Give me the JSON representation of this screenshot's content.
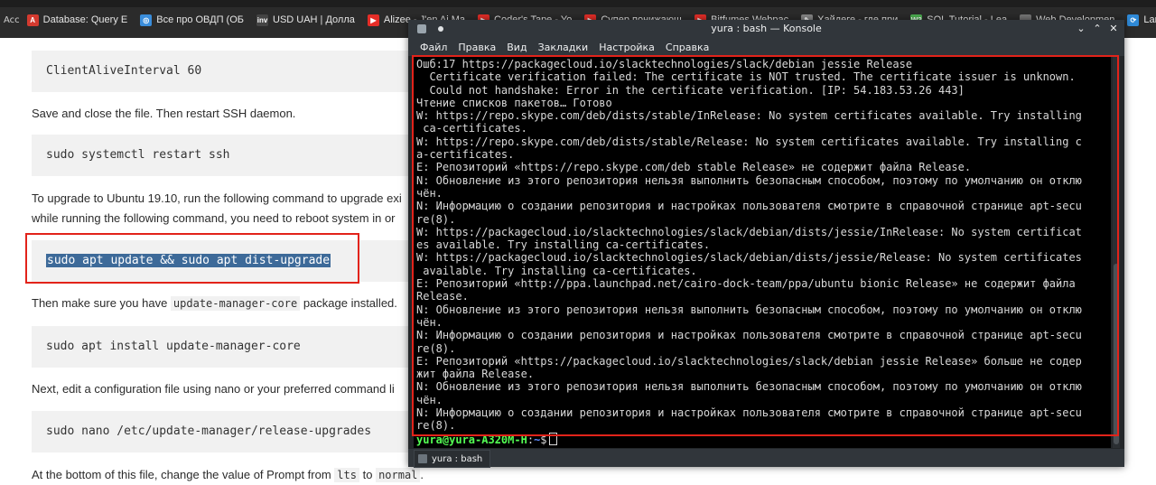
{
  "bookmarks": {
    "first_label": "Acc",
    "items": [
      {
        "label": "Database: Query E",
        "icon": "db-icon",
        "color": "#d43a2f",
        "glyph": "A"
      },
      {
        "label": "Все про ОВДП (ОБ",
        "icon": "globe-icon",
        "color": "#3a8ddb",
        "glyph": "◎"
      },
      {
        "label": "USD UAH | Долла",
        "icon": "chart-icon",
        "color": "#444444",
        "glyph": "inv"
      },
      {
        "label": "Alizee - J'en Ai Ma",
        "icon": "youtube-icon",
        "color": "#e52d27",
        "glyph": "▶"
      },
      {
        "label": "Coder's Tape - Yo",
        "icon": "youtube-icon",
        "color": "#e52d27",
        "glyph": "▶"
      },
      {
        "label": "Супер понижающ",
        "icon": "youtube-icon",
        "color": "#e52d27",
        "glyph": "▶"
      },
      {
        "label": "Bitfumes Webpac",
        "icon": "youtube-icon",
        "color": "#e52d27",
        "glyph": "▶"
      },
      {
        "label": "Хайдеге - где при",
        "icon": "doc-icon",
        "color": "#888888",
        "glyph": "✎"
      },
      {
        "label": "SQL Tutorial - Lea",
        "icon": "w3-icon",
        "color": "#4caf50",
        "glyph": "W3"
      },
      {
        "label": "Web Developmen",
        "icon": "folder-icon",
        "color": "#777777",
        "glyph": "▬"
      },
      {
        "label": "Laravel - Все о WE",
        "icon": "laravel-icon",
        "color": "#2f8ad8",
        "glyph": "⟳"
      }
    ]
  },
  "article": {
    "code1": "ClientAliveInterval 60",
    "para1": "Save and close the file. Then restart SSH daemon.",
    "code2": "sudo systemctl restart ssh",
    "para2_line1": "To upgrade to Ubuntu 19.10, run the following command to upgrade exi",
    "para2_line2": "while running the following command, you need to reboot system in or",
    "code3": "sudo apt update && sudo apt dist-upgrade",
    "para3_pre": "Then make sure you have ",
    "para3_code": "update-manager-core",
    "para3_post": " package installed.",
    "code4": "sudo apt install update-manager-core",
    "para4": "Next, edit a configuration file using nano or your preferred command li",
    "code5": "sudo nano /etc/update-manager/release-upgrades",
    "para5_pre": "At the bottom of this file, change the value of Prompt from ",
    "para5_code1": "lts",
    "para5_mid": " to ",
    "para5_code2": "normal",
    "para5_post": "."
  },
  "konsole": {
    "title": "yura : bash — Konsole",
    "menu": [
      "Файл",
      "Правка",
      "Вид",
      "Закладки",
      "Настройка",
      "Справка"
    ],
    "window_controls": {
      "minimize": "⌄",
      "maximize": "⌃",
      "close": "✕"
    },
    "lines": [
      "Ошб:17 https://packagecloud.io/slacktechnologies/slack/debian jessie Release",
      "  Certificate verification failed: The certificate is NOT trusted. The certificate issuer is unknown.",
      "  Could not handshake: Error in the certificate verification. [IP: 54.183.53.26 443]",
      "Чтение списков пакетов… Готово",
      "W: https://repo.skype.com/deb/dists/stable/InRelease: No system certificates available. Try installing",
      " ca-certificates.",
      "W: https://repo.skype.com/deb/dists/stable/Release: No system certificates available. Try installing c",
      "a-certificates.",
      "E: Репозиторий «https://repo.skype.com/deb stable Release» не содержит файла Release.",
      "N: Обновление из этого репозитория нельзя выполнить безопасным способом, поэтому по умолчанию он отклю",
      "чён.",
      "N: Информацию о создании репозитория и настройках пользователя смотрите в справочной странице apt-secu",
      "re(8).",
      "W: https://packagecloud.io/slacktechnologies/slack/debian/dists/jessie/InRelease: No system certificat",
      "es available. Try installing ca-certificates.",
      "W: https://packagecloud.io/slacktechnologies/slack/debian/dists/jessie/Release: No system certificates",
      " available. Try installing ca-certificates.",
      "E: Репозиторий «http://ppa.launchpad.net/cairo-dock-team/ppa/ubuntu bionic Release» не содержит файла",
      "Release.",
      "N: Обновление из этого репозитория нельзя выполнить безопасным способом, поэтому по умолчанию он отклю",
      "чён.",
      "N: Информацию о создании репозитория и настройках пользователя смотрите в справочной странице apt-secu",
      "re(8).",
      "E: Репозиторий «https://packagecloud.io/slacktechnologies/slack/debian jessie Release» больше не содер",
      "жит файла Release.",
      "N: Обновление из этого репозитория нельзя выполнить безопасным способом, поэтому по умолчанию он отклю",
      "чён.",
      "N: Информацию о создании репозитория и настройках пользователя смотрите в справочной странице apt-secu",
      "re(8)."
    ],
    "prompt": {
      "user_host": "yura@yura-A320M-H",
      "sep": ":",
      "path": "~",
      "symbol": "$"
    },
    "tab_label": "yura : bash"
  },
  "colors": {
    "highlight_box": "#e2231a",
    "selection": "#3d6a99",
    "terminal_bg": "#000000",
    "prompt_user": "#54ff54",
    "prompt_path": "#5c8aff"
  }
}
